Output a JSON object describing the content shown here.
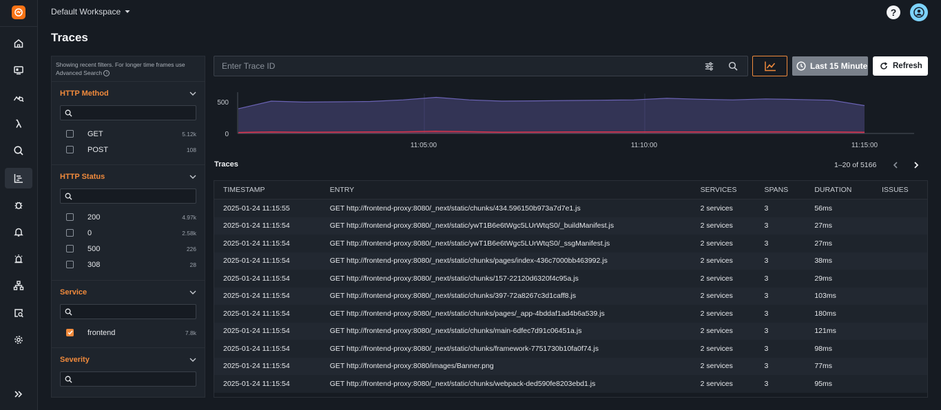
{
  "header": {
    "workspace": "Default Workspace",
    "page_title": "Traces"
  },
  "filters": {
    "note": "Showing recent filters. For longer time frames use Advanced Search",
    "sections": [
      {
        "title": "HTTP Method",
        "options": [
          {
            "label": "GET",
            "count": "5.12k",
            "checked": false
          },
          {
            "label": "POST",
            "count": "108",
            "checked": false
          }
        ]
      },
      {
        "title": "HTTP Status",
        "options": [
          {
            "label": "200",
            "count": "4.97k",
            "checked": false
          },
          {
            "label": "0",
            "count": "2.58k",
            "checked": false
          },
          {
            "label": "500",
            "count": "226",
            "checked": false
          },
          {
            "label": "308",
            "count": "28",
            "checked": false
          }
        ]
      },
      {
        "title": "Service",
        "options": [
          {
            "label": "frontend",
            "count": "7.8k",
            "checked": true
          }
        ]
      },
      {
        "title": "Severity",
        "options": []
      }
    ]
  },
  "toolbar": {
    "trace_placeholder": "Enter Trace ID",
    "time_range": "Last 15 Minute",
    "refresh_label": "Refresh"
  },
  "chart_data": {
    "type": "area",
    "y_ticks": [
      "500",
      "0"
    ],
    "x_ticks": [
      "11:05:00",
      "11:10:00",
      "11:15:00"
    ],
    "ylim": [
      0,
      630
    ],
    "series": [
      {
        "color": "#6b63b5",
        "values": [
          390,
          510,
          495,
          500,
          505,
          530,
          570,
          530,
          510,
          515,
          520,
          525,
          530,
          555,
          540,
          530,
          545,
          535,
          525,
          440
        ]
      },
      {
        "color": "#d6344a",
        "values": [
          15,
          25,
          20,
          22,
          24,
          26,
          35,
          28,
          20,
          22,
          24,
          25,
          24,
          26,
          25,
          24,
          26,
          25,
          24,
          20
        ]
      }
    ]
  },
  "traces": {
    "title": "Traces",
    "pagination": "1–20 of 5166",
    "columns": [
      "TIMESTAMP",
      "ENTRY",
      "SERVICES",
      "SPANS",
      "DURATION",
      "ISSUES"
    ],
    "rows": [
      [
        "2025-01-24 11:15:55",
        "GET http://frontend-proxy:8080/_next/static/chunks/434.596150b973a7d7e1.js",
        "2 services",
        "3",
        "56ms",
        ""
      ],
      [
        "2025-01-24 11:15:54",
        "GET http://frontend-proxy:8080/_next/static/ywT1B6e6tWgc5LUrWtqS0/_buildManifest.js",
        "2 services",
        "3",
        "27ms",
        ""
      ],
      [
        "2025-01-24 11:15:54",
        "GET http://frontend-proxy:8080/_next/static/ywT1B6e6tWgc5LUrWtqS0/_ssgManifest.js",
        "2 services",
        "3",
        "27ms",
        ""
      ],
      [
        "2025-01-24 11:15:54",
        "GET http://frontend-proxy:8080/_next/static/chunks/pages/index-436c7000bb463992.js",
        "2 services",
        "3",
        "38ms",
        ""
      ],
      [
        "2025-01-24 11:15:54",
        "GET http://frontend-proxy:8080/_next/static/chunks/157-22120d6320f4c95a.js",
        "2 services",
        "3",
        "29ms",
        ""
      ],
      [
        "2025-01-24 11:15:54",
        "GET http://frontend-proxy:8080/_next/static/chunks/397-72a8267c3d1caff8.js",
        "2 services",
        "3",
        "103ms",
        ""
      ],
      [
        "2025-01-24 11:15:54",
        "GET http://frontend-proxy:8080/_next/static/chunks/pages/_app-4bddaf1ad4b6a539.js",
        "2 services",
        "3",
        "180ms",
        ""
      ],
      [
        "2025-01-24 11:15:54",
        "GET http://frontend-proxy:8080/_next/static/chunks/main-6dfec7d91c06451a.js",
        "2 services",
        "3",
        "121ms",
        ""
      ],
      [
        "2025-01-24 11:15:54",
        "GET http://frontend-proxy:8080/_next/static/chunks/framework-7751730b10fa0f74.js",
        "2 services",
        "3",
        "98ms",
        ""
      ],
      [
        "2025-01-24 11:15:54",
        "GET http://frontend-proxy:8080/images/Banner.png",
        "2 services",
        "3",
        "77ms",
        ""
      ],
      [
        "2025-01-24 11:15:54",
        "GET http://frontend-proxy:8080/_next/static/chunks/webpack-ded590fe8203ebd1.js",
        "2 services",
        "3",
        "95ms",
        ""
      ]
    ]
  },
  "nav": {
    "items": [
      "home-icon",
      "dashboard-icon",
      "metrics-icon",
      "lambda-icon",
      "search-icon",
      "traces-icon",
      "bug-icon",
      "bell-icon",
      "alarm-icon",
      "topology-icon",
      "query-icon",
      "settings-icon"
    ],
    "active": "traces-icon"
  }
}
